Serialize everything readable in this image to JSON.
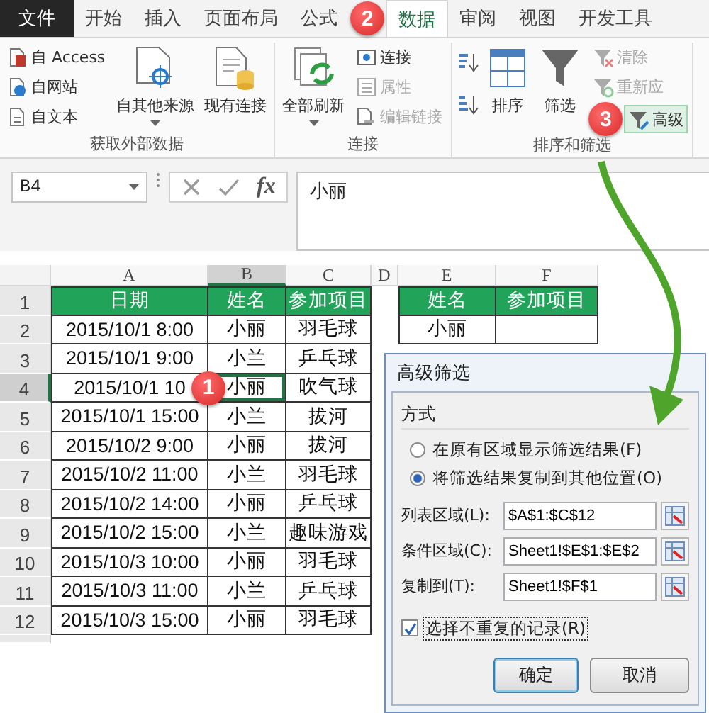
{
  "tabs": [
    {
      "label": "文件",
      "kind": "file",
      "selected": false
    },
    {
      "label": "开始",
      "kind": "tab",
      "selected": false
    },
    {
      "label": "插入",
      "kind": "tab",
      "selected": false
    },
    {
      "label": "页面布局",
      "kind": "tab",
      "selected": false
    },
    {
      "label": "公式",
      "kind": "tab",
      "selected": false
    },
    {
      "label": "数据",
      "kind": "tab",
      "selected": true
    },
    {
      "label": "审阅",
      "kind": "tab",
      "selected": false
    },
    {
      "label": "视图",
      "kind": "tab",
      "selected": false
    },
    {
      "label": "开发工具",
      "kind": "tab",
      "selected": false
    }
  ],
  "ribbon_groups": [
    {
      "label": "获取外部数据",
      "columns": [
        {
          "kind": "stack",
          "items": [
            {
              "label": "自 Access",
              "disabled": false,
              "selected": false
            },
            {
              "label": "自网站",
              "disabled": false,
              "selected": false
            },
            {
              "label": "自文本",
              "disabled": false,
              "selected": false
            }
          ]
        },
        {
          "kind": "large",
          "label": "自其他来源",
          "dropdown": true
        },
        {
          "kind": "large",
          "label": "现有连接",
          "dropdown": false
        }
      ]
    },
    {
      "label": "连接",
      "columns": [
        {
          "kind": "large",
          "label": "全部刷新",
          "dropdown": true
        },
        {
          "kind": "stack",
          "items": [
            {
              "label": "连接",
              "disabled": false,
              "selected": false
            },
            {
              "label": "属性",
              "disabled": true,
              "selected": false
            },
            {
              "label": "编辑链接",
              "disabled": true,
              "selected": false
            }
          ]
        }
      ]
    },
    {
      "label": "排序和筛选",
      "columns": [
        {
          "kind": "sort-icons"
        },
        {
          "kind": "large",
          "label": "排序",
          "dropdown": false
        },
        {
          "kind": "large",
          "label": "筛选",
          "dropdown": false
        },
        {
          "kind": "stack",
          "items": [
            {
              "label": "清除",
              "disabled": true,
              "selected": false
            },
            {
              "label": "重新应",
              "disabled": true,
              "selected": false
            },
            {
              "label": "高级",
              "disabled": false,
              "selected": true
            }
          ]
        }
      ]
    }
  ],
  "formula_bar": {
    "name_box": "B4",
    "function_label": "fx",
    "formula": "小丽"
  },
  "sheet": {
    "columns": [
      {
        "label": "A",
        "selected": false
      },
      {
        "label": "B",
        "selected": true
      },
      {
        "label": "C",
        "selected": false
      },
      {
        "label": "D",
        "selected": false
      },
      {
        "label": "E",
        "selected": false
      },
      {
        "label": "F",
        "selected": false
      }
    ],
    "rows": [
      {
        "number": "1",
        "kind": "header",
        "selected": false,
        "cells": {
          "A": "日期",
          "B": "姓名",
          "C": "参加项目",
          "E": "姓名",
          "F": "参加项目"
        }
      },
      {
        "number": "2",
        "kind": "data",
        "selected": false,
        "cells": {
          "A": "2015/10/1 8:00",
          "B": "小丽",
          "C": "羽毛球",
          "E": "小丽"
        }
      },
      {
        "number": "3",
        "kind": "data",
        "selected": false,
        "cells": {
          "A": "2015/10/1 9:00",
          "B": "小兰",
          "C": "乒乓球"
        }
      },
      {
        "number": "4",
        "kind": "data",
        "selected": true,
        "cells": {
          "A": "2015/10/1 10",
          "B": "小丽",
          "C": "吹气球"
        }
      },
      {
        "number": "5",
        "kind": "data",
        "selected": false,
        "cells": {
          "A": "2015/10/1 15:00",
          "B": "小兰",
          "C": "拔河"
        }
      },
      {
        "number": "6",
        "kind": "data",
        "selected": false,
        "cells": {
          "A": "2015/10/2 9:00",
          "B": "小丽",
          "C": "拔河"
        }
      },
      {
        "number": "7",
        "kind": "data",
        "selected": false,
        "cells": {
          "A": "2015/10/2 11:00",
          "B": "小兰",
          "C": "羽毛球"
        }
      },
      {
        "number": "8",
        "kind": "data",
        "selected": false,
        "cells": {
          "A": "2015/10/2 14:00",
          "B": "小丽",
          "C": "乒乓球"
        }
      },
      {
        "number": "9",
        "kind": "data",
        "selected": false,
        "cells": {
          "A": "2015/10/2 15:00",
          "B": "小兰",
          "C": "趣味游戏"
        }
      },
      {
        "number": "10",
        "kind": "data",
        "selected": false,
        "cells": {
          "A": "2015/10/3 10:00",
          "B": "小丽",
          "C": "羽毛球"
        }
      },
      {
        "number": "11",
        "kind": "data",
        "selected": false,
        "cells": {
          "A": "2015/10/3 11:00",
          "B": "小兰",
          "C": "乒乓球"
        }
      },
      {
        "number": "12",
        "kind": "data",
        "selected": false,
        "cells": {
          "A": "2015/10/3 15:00",
          "B": "小丽",
          "C": "羽毛球"
        }
      }
    ]
  },
  "dialog": {
    "title": "高级筛选",
    "section": "方式",
    "options": [
      {
        "label": "在原有区域显示筛选结果(F)",
        "selected": false
      },
      {
        "label": "将筛选结果复制到其他位置(O)",
        "selected": true
      }
    ],
    "fields": [
      {
        "label": "列表区域(L):",
        "value": "$A$1:$C$12"
      },
      {
        "label": "条件区域(C):",
        "value": "Sheet1!$E$1:$E$2"
      },
      {
        "label": "复制到(T):",
        "value": "Sheet1!$F$1"
      }
    ],
    "checkbox": {
      "label": "选择不重复的记录(R)",
      "checked": true
    },
    "buttons": [
      {
        "label": "确定",
        "kind": "default"
      },
      {
        "label": "取消",
        "kind": "normal"
      }
    ]
  },
  "callouts": [
    {
      "label": "2"
    },
    {
      "label": "3"
    },
    {
      "label": "1"
    }
  ]
}
